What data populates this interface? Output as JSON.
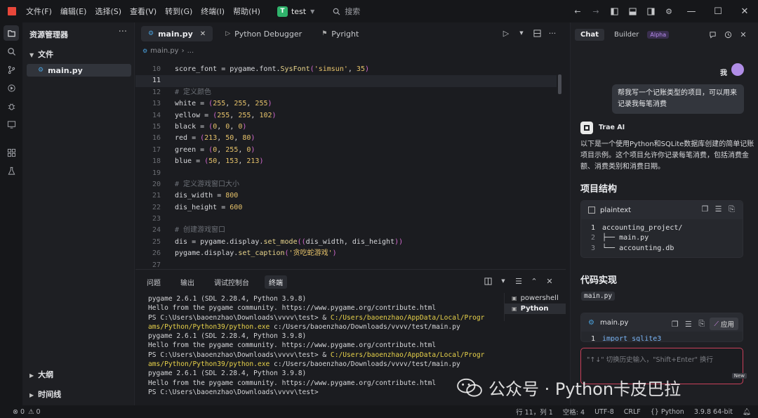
{
  "titlebar": {
    "menu": [
      "文件(F)",
      "编辑(E)",
      "选择(S)",
      "查看(V)",
      "转到(G)",
      "终端(I)",
      "帮助(H)"
    ],
    "project_badge": "T",
    "project_name": "test",
    "search_label": "搜索",
    "logo_color": "#e8473a"
  },
  "explorer": {
    "title": "资源管理器",
    "files_section": "文件",
    "file": "main.py",
    "outline_section": "大纲",
    "timeline_section": "时间线"
  },
  "editor": {
    "tabs": [
      {
        "label": "main.py",
        "active": true
      },
      {
        "label": "Python Debugger",
        "active": false
      },
      {
        "label": "Pyright",
        "active": false
      }
    ],
    "breadcrumb": [
      "main.py",
      "..."
    ],
    "current_line": 11,
    "lines": [
      {
        "n": "10",
        "text": "score_font = pygame.font.SysFont('simsun', 35)"
      },
      {
        "n": "11",
        "text": ""
      },
      {
        "n": "12",
        "text": "# 定义颜色"
      },
      {
        "n": "13",
        "text": "white = (255, 255, 255)"
      },
      {
        "n": "14",
        "text": "yellow = (255, 255, 102)"
      },
      {
        "n": "15",
        "text": "black = (0, 0, 0)"
      },
      {
        "n": "16",
        "text": "red = (213, 50, 80)"
      },
      {
        "n": "17",
        "text": "green = (0, 255, 0)"
      },
      {
        "n": "18",
        "text": "blue = (50, 153, 213)"
      },
      {
        "n": "19",
        "text": ""
      },
      {
        "n": "20",
        "text": "# 定义游戏窗口大小"
      },
      {
        "n": "21",
        "text": "dis_width = 800"
      },
      {
        "n": "22",
        "text": "dis_height = 600"
      },
      {
        "n": "23",
        "text": ""
      },
      {
        "n": "24",
        "text": "# 创建游戏窗口"
      },
      {
        "n": "25",
        "text": "dis = pygame.display.set_mode((dis_width, dis_height))"
      },
      {
        "n": "26",
        "text": "pygame.display.set_caption('贪吃蛇游戏')"
      },
      {
        "n": "27",
        "text": ""
      }
    ]
  },
  "panel": {
    "tabs": [
      {
        "label": "问题",
        "active": false
      },
      {
        "label": "输出",
        "active": false
      },
      {
        "label": "调试控制台",
        "active": false
      },
      {
        "label": "终端",
        "active": true
      }
    ],
    "terminal_lines": [
      {
        "plain": "pygame 2.6.1 (SDL 2.28.4, Python 3.9.8)",
        "hl": "",
        "tail": ""
      },
      {
        "plain": "Hello from the pygame community. https://www.pygame.org/contribute.html",
        "hl": "",
        "tail": ""
      },
      {
        "plain": "PS C:\\Users\\baoenzhao\\Downloads\\vvvv\\test> & ",
        "hl": "C:/Users/baoenzhao/AppData/Local/Progr",
        "tail": ""
      },
      {
        "plain": "",
        "hl": "ams/Python/Python39/python.exe",
        "tail": " c:/Users/baoenzhao/Downloads/vvvv/test/main.py"
      },
      {
        "plain": "pygame 2.6.1 (SDL 2.28.4, Python 3.9.8)",
        "hl": "",
        "tail": ""
      },
      {
        "plain": "Hello from the pygame community. https://www.pygame.org/contribute.html",
        "hl": "",
        "tail": ""
      },
      {
        "plain": "PS C:\\Users\\baoenzhao\\Downloads\\vvvv\\test> & ",
        "hl": "C:/Users/baoenzhao/AppData/Local/Progr",
        "tail": ""
      },
      {
        "plain": "",
        "hl": "ams/Python/Python39/python.exe",
        "tail": " c:/Users/baoenzhao/Downloads/vvvv/test/main.py"
      },
      {
        "plain": "pygame 2.6.1 (SDL 2.28.4, Python 3.9.8)",
        "hl": "",
        "tail": ""
      },
      {
        "plain": "Hello from the pygame community. https://www.pygame.org/contribute.html",
        "hl": "",
        "tail": ""
      },
      {
        "plain": "PS C:\\Users\\baoenzhao\\Downloads\\vvvv\\test>",
        "hl": "",
        "tail": ""
      }
    ],
    "terminals": [
      {
        "label": "powershell",
        "active": false
      },
      {
        "label": "Python",
        "active": true
      }
    ]
  },
  "chat": {
    "tabs": [
      {
        "label": "Chat",
        "active": true
      },
      {
        "label": "Builder",
        "active": false
      }
    ],
    "alpha_badge": "Alpha",
    "user_label": "我",
    "user_message": "帮我写一个记账类型的项目，可以用来记录我每笔消费",
    "ai_name": "Trae AI",
    "ai_intro": "以下是一个使用Python和SQLite数据库创建的简单记账项目示例。这个项目允许你记录每笔消费，包括消费金额、消费类别和消费日期。",
    "heading_structure": "项目结构",
    "tree_card": {
      "lang": "plaintext",
      "lines": [
        {
          "n": "1",
          "text": "accounting_project/"
        },
        {
          "n": "2",
          "text": "├── main.py"
        },
        {
          "n": "3",
          "text": "└── accounting.db"
        }
      ]
    },
    "heading_impl": "代码实现",
    "file_chip": "main.py",
    "code_card": {
      "lang": "main.py",
      "apply_label": "应用",
      "lines": [
        {
          "n": "1",
          "text": "import sqlite3"
        }
      ]
    },
    "input_placeholder": "\"↑↓\" 切换历史输入，\"Shift+Enter\" 换行",
    "new_badge": "New",
    "input_border_color": "#c9405a"
  },
  "statusbar": {
    "errors": "0",
    "warnings": "0",
    "position": "行 11，列 1",
    "spaces": "空格: 4",
    "encoding": "UTF-8",
    "eol": "CRLF",
    "language": "Python",
    "interpreter": "3.9.8 64-bit"
  },
  "watermark": {
    "text": "公众号 · Python卡皮巴拉"
  }
}
